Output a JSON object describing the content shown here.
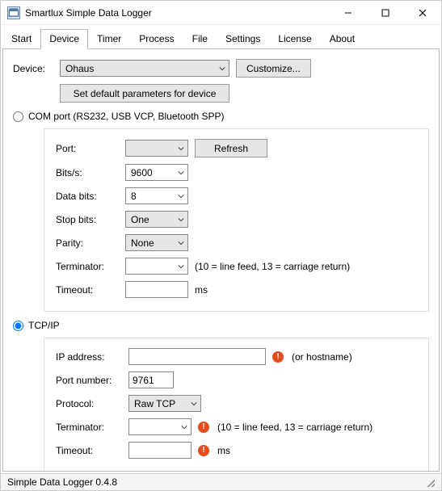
{
  "window": {
    "title": "Smartlux Simple Data Logger"
  },
  "tabs": {
    "items": [
      "Start",
      "Device",
      "Timer",
      "Process",
      "File",
      "Settings",
      "License",
      "About"
    ],
    "active": "Device"
  },
  "device": {
    "label": "Device:",
    "selected": "Ohaus",
    "customize_btn": "Customize...",
    "set_defaults_btn": "Set default parameters for device"
  },
  "com": {
    "radio_label": "COM port (RS232, USB VCP, Bluetooth SPP)",
    "checked": false,
    "port_label": "Port:",
    "port_value": "",
    "refresh_btn": "Refresh",
    "bits_label": "Bits/s:",
    "bits_value": "9600",
    "databits_label": "Data bits:",
    "databits_value": "8",
    "stopbits_label": "Stop bits:",
    "stopbits_value": "One",
    "parity_label": "Parity:",
    "parity_value": "None",
    "terminator_label": "Terminator:",
    "terminator_value": "",
    "terminator_hint": "(10 = line feed, 13 = carriage return)",
    "timeout_label": "Timeout:",
    "timeout_value": "",
    "timeout_unit": "ms"
  },
  "tcp": {
    "radio_label": "TCP/IP",
    "checked": true,
    "ip_label": "IP address:",
    "ip_value": "",
    "ip_hint": "(or hostname)",
    "port_label": "Port number:",
    "port_value": "9761",
    "protocol_label": "Protocol:",
    "protocol_value": "Raw TCP",
    "terminator_label": "Terminator:",
    "terminator_value": "",
    "terminator_hint": "(10 = line feed, 13 = carriage return)",
    "timeout_label": "Timeout:",
    "timeout_value": "",
    "timeout_unit": "ms"
  },
  "status": {
    "text": "Simple Data Logger 0.4.8"
  }
}
